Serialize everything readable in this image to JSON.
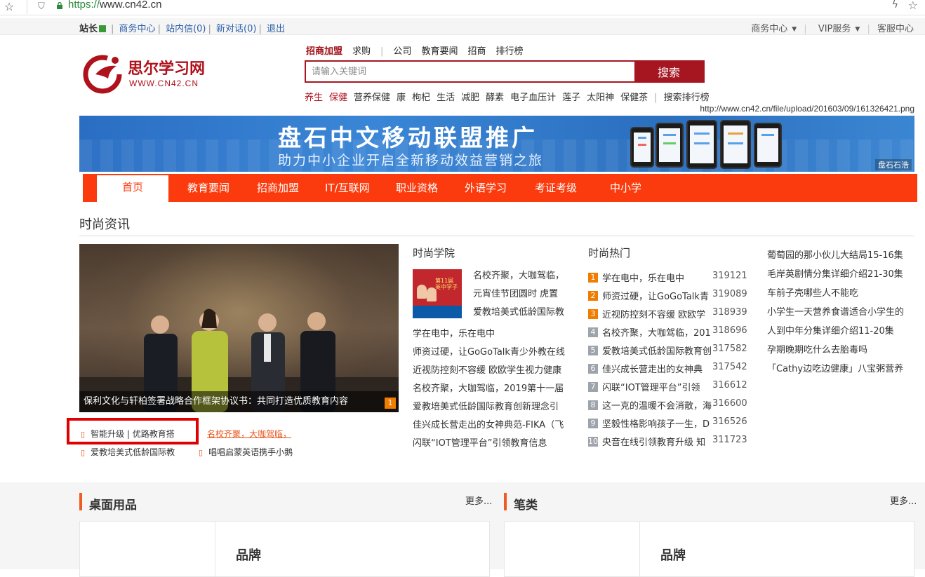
{
  "browser": {
    "url_scheme": "https://",
    "url_host": "www.cn42.cn"
  },
  "topbar": {
    "user": "站长",
    "links": [
      "商务中心",
      "站内信(0)",
      "新对话(0)",
      "退出"
    ],
    "right": [
      {
        "label": "商务中心",
        "dropdown": true
      },
      {
        "label": "VIP服务",
        "dropdown": true
      },
      {
        "label": "客服中心",
        "dropdown": false
      }
    ]
  },
  "logo": {
    "name": "思尔学习网",
    "domain": "WWW.CN42.CN"
  },
  "search": {
    "tabs": [
      "招商加盟",
      "求购",
      "公司",
      "教育要闻",
      "招商",
      "排行榜"
    ],
    "active_tab": "招商加盟",
    "placeholder": "请输入关键词",
    "button": "搜索",
    "hotwords": [
      {
        "text": "养生",
        "red": true
      },
      {
        "text": "保健",
        "red": true
      },
      {
        "text": "营养保健",
        "red": false
      },
      {
        "text": "康",
        "red": false
      },
      {
        "text": "枸杞",
        "red": false
      },
      {
        "text": "生活",
        "red": false
      },
      {
        "text": "减肥",
        "red": false
      },
      {
        "text": "酵素",
        "red": false
      },
      {
        "text": "电子血压计",
        "red": false
      },
      {
        "text": "莲子",
        "red": false
      },
      {
        "text": "太阳神",
        "red": false
      },
      {
        "text": "保健茶",
        "red": false
      }
    ],
    "ranking_link": "搜索排行榜"
  },
  "url_tip": "http://www.cn42.cn/file/upload/201603/09/161326421.png",
  "banner": {
    "title": "盘石中文移动联盟推广",
    "subtitle": "助力中小企业开启全新移动效益营销之旅",
    "brand": "盘石石浩"
  },
  "nav": [
    "首页",
    "教育要闻",
    "招商加盟",
    "IT/互联网",
    "职业资格",
    "外语学习",
    "考证考级",
    "中小学"
  ],
  "section": {
    "title": "时尚资讯",
    "feature": {
      "caption": "保利文化与轩柏签署战略合作框架协议书：共同打造优质教育内容",
      "index": "1"
    },
    "sublinks": [
      [
        "智能升级 | 优路教育搭",
        "名校齐聚，大咖驾临，"
      ],
      [
        "爱教培美式低龄国际教",
        "唱唱启蒙英语携手小鹅"
      ]
    ],
    "college": {
      "title": "时尚学院",
      "thumb_text": "第11届 英中学子",
      "beside": [
        "名校齐聚，大咖驾临，",
        "元宵佳节团圆时 虎置",
        "爱教培美式低龄国际教"
      ],
      "lines": [
        "学在电中，乐在电中",
        "师资过硬，让GoGoTalk青少外教在线",
        "近视防控刻不容缓 欧欧学生视力健康",
        "名校齐聚，大咖驾临，2019第十一届",
        "爱教培美式低龄国际教育创新理念引",
        "佳兴成长营走出的女神典范-FIKA（飞",
        "闪联“IOT管理平台”引领教育信息"
      ]
    },
    "hot": {
      "title": "时尚热门",
      "items": [
        {
          "n": "1",
          "t": "学在电中，乐在电中",
          "v": "319121"
        },
        {
          "n": "2",
          "t": "师资过硬，让GoGoTalk青",
          "v": "319089"
        },
        {
          "n": "3",
          "t": "近视防控刻不容缓 欧欧学",
          "v": "318939"
        },
        {
          "n": "4",
          "t": "名校齐聚，大咖驾临，201",
          "v": "318696"
        },
        {
          "n": "5",
          "t": "爱教培美式低龄国际教育创",
          "v": "317582"
        },
        {
          "n": "6",
          "t": "佳兴成长营走出的女神典",
          "v": "317542"
        },
        {
          "n": "7",
          "t": "闪联“IOT管理平台”引领",
          "v": "316612"
        },
        {
          "n": "8",
          "t": "这一克的温暖不会消散，海",
          "v": "316600"
        },
        {
          "n": "9",
          "t": "坚毅性格影响孩子一生，D",
          "v": "316526"
        },
        {
          "n": "10",
          "t": "央音在线引领教育升级 知",
          "v": "311723"
        }
      ]
    },
    "right_list": [
      "葡萄园的那小伙儿大结局15-16集",
      "毛岸英剧情分集详细介绍21-30集",
      "车前子壳哪些人不能吃",
      "小学生一天营养食谱适合小学生的",
      "人到中年分集详细介绍11-20集",
      "孕期晚期吃什么去胎毒吗",
      "「Cathy边吃边健康」八宝粥营养"
    ]
  },
  "categories": [
    {
      "name": "桌面用品",
      "more": "更多...",
      "brand": "品牌"
    },
    {
      "name": "笔类",
      "more": "更多...",
      "brand": "品牌"
    }
  ],
  "colors": {
    "brand_red": "#a51621",
    "nav_orange": "#fb3b0d",
    "accent_orange": "#f07c00",
    "link_blue": "#2b5fa8"
  }
}
